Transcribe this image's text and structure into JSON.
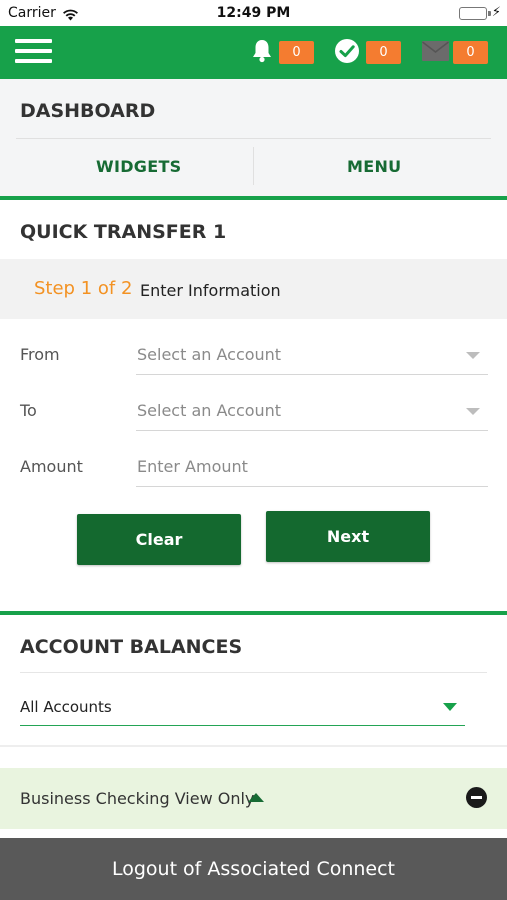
{
  "status_bar": {
    "carrier": "Carrier",
    "time": "12:49 PM"
  },
  "header": {
    "notifications": {
      "icon": "bell-icon",
      "count": "0"
    },
    "approvals": {
      "icon": "check-circle-icon",
      "count": "0"
    },
    "messages": {
      "icon": "envelope-icon",
      "count": "0"
    },
    "menu_icon": "hamburger-menu-icon"
  },
  "dashboard": {
    "title": "DASHBOARD",
    "tabs": [
      {
        "label": "WIDGETS"
      },
      {
        "label": "MENU"
      }
    ]
  },
  "quick_transfer": {
    "title": "QUICK TRANSFER 1",
    "step": "Step 1 of 2",
    "step_label": "Enter Information",
    "fields": {
      "from": {
        "label": "From",
        "placeholder": "Select an Account"
      },
      "to": {
        "label": "To",
        "placeholder": "Select an Account"
      },
      "amount": {
        "label": "Amount",
        "placeholder": "Enter Amount"
      }
    },
    "clear_label": "Clear",
    "next_label": "Next"
  },
  "account_balances": {
    "title": "ACCOUNT BALANCES",
    "filter_value": "All Accounts",
    "group_label": "Business Checking View Only"
  },
  "footer": {
    "logout_label": "Logout of Associated Connect"
  },
  "colors": {
    "brand_green": "#17a14a",
    "button_green": "#14692f",
    "accent_orange": "#f39223",
    "badge_orange": "#f47c30",
    "footer_gray": "#595959"
  }
}
